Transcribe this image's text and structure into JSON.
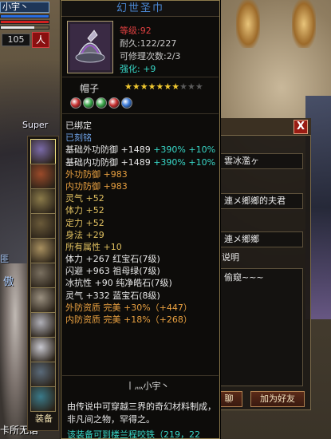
{
  "player": {
    "name": "小宇丶",
    "level": "105",
    "badge": "人"
  },
  "world": {
    "label_super": "Super",
    "label_left_1": "匪",
    "label_left_2": "傲",
    "label_bottom": "卡所无语"
  },
  "tooltip": {
    "title": "幻世圣巾",
    "level_line": "等级:92",
    "durability": "耐久:122/227",
    "repair": "可修理次数:2/3",
    "enhance_label": "强化:",
    "enhance_value": "+9",
    "item_type": "帽子",
    "stars_total": 10,
    "stars_filled": 7,
    "gems": [
      "red-gem",
      "green-gem",
      "green-gem",
      "red-gem",
      "blue-gem"
    ],
    "lines": [
      {
        "text": "已绑定",
        "color": "white"
      },
      {
        "text": "已刻铭",
        "color": "blue"
      },
      {
        "text": "基础外功防御 +1489",
        "extra": "+390% +10%",
        "color": "white"
      },
      {
        "text": "基础内功防御 +1489",
        "extra": "+390% +10%",
        "color": "white"
      },
      {
        "text": "外功防御 +983",
        "color": "orange"
      },
      {
        "text": "内功防御 +983",
        "color": "orange"
      },
      {
        "text": "灵气 +52",
        "color": "gold"
      },
      {
        "text": "体力 +52",
        "color": "gold"
      },
      {
        "text": "定力 +52",
        "color": "gold"
      },
      {
        "text": "身法 +29",
        "color": "gold"
      },
      {
        "text": "所有属性 +10",
        "color": "gold"
      },
      {
        "text": "体力 +267 红宝石(7级)",
        "color": "white"
      },
      {
        "text": "闪避 +963 祖母绿(7级)",
        "color": "white"
      },
      {
        "text": "冰抗性 +90 纯净皓石(7级)",
        "color": "white"
      },
      {
        "text": "灵气 +332 蓝宝石(8级)",
        "color": "white"
      },
      {
        "text": "外防资质  完美 +30%（+447）",
        "color": "orange"
      },
      {
        "text": "内防资质  完美 +18%（+268）",
        "color": "orange"
      }
    ],
    "owner": "丨灬小宇丶",
    "description": "由传说中可穿越三界的奇幻材料制成，非凡间之物，罕得之。",
    "footer": "该装备可到楼兰程咬铁（219，22"
  },
  "dialog": {
    "close_label": "X",
    "field_1": "雲冰濫ヶ",
    "field_2": "連メ鄉鄉的夫君",
    "field_3": "連メ鄉鄉",
    "label_note": "说明",
    "memo": "偷窥~~~",
    "btn_chat": "聊",
    "btn_add_friend": "加为好友"
  },
  "equipment": {
    "label": "装备",
    "slots": [
      "hat-icon",
      "scroll-icon",
      "bracer-icon",
      "glove-icon",
      "shoulder-icon",
      "armor-icon",
      "belt-icon",
      "ring-icon",
      "ring-icon",
      "amulet-icon",
      "weapon-icon"
    ]
  },
  "colors": {
    "title_blue": "#4a86d0",
    "stat_orange": "#e8a040",
    "stat_gold": "#e0c060",
    "stat_cyan": "#38d8c8",
    "stat_blue": "#6fa3e8",
    "level_red": "#e04040"
  }
}
